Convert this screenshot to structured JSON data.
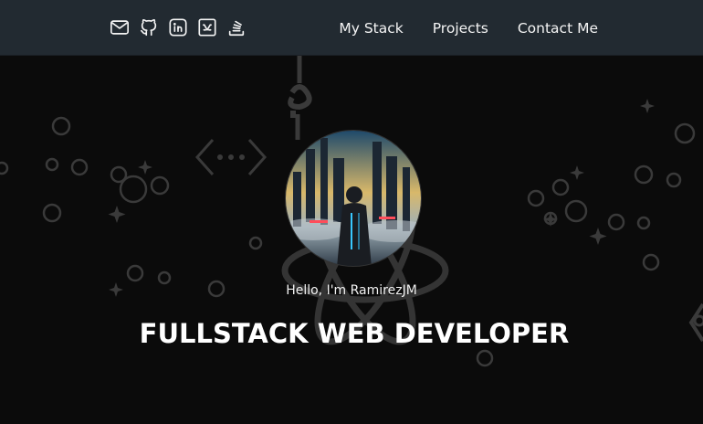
{
  "navbar": {
    "social_icons": [
      {
        "name": "mail-icon"
      },
      {
        "name": "github-icon"
      },
      {
        "name": "linkedin-icon"
      },
      {
        "name": "medium-icon"
      },
      {
        "name": "stackoverflow-icon"
      }
    ],
    "links": [
      {
        "label": "My Stack"
      },
      {
        "label": "Projects"
      },
      {
        "label": "Contact Me"
      }
    ]
  },
  "hero": {
    "greeting": "Hello, I'm RamirezJM",
    "headline": "FULLSTACK WEB DEVELOPER"
  },
  "colors": {
    "navbar_bg": "#222a31",
    "page_bg": "#0b0b0b",
    "text": "#f4f4f4",
    "decor": "#3a3a3a"
  }
}
